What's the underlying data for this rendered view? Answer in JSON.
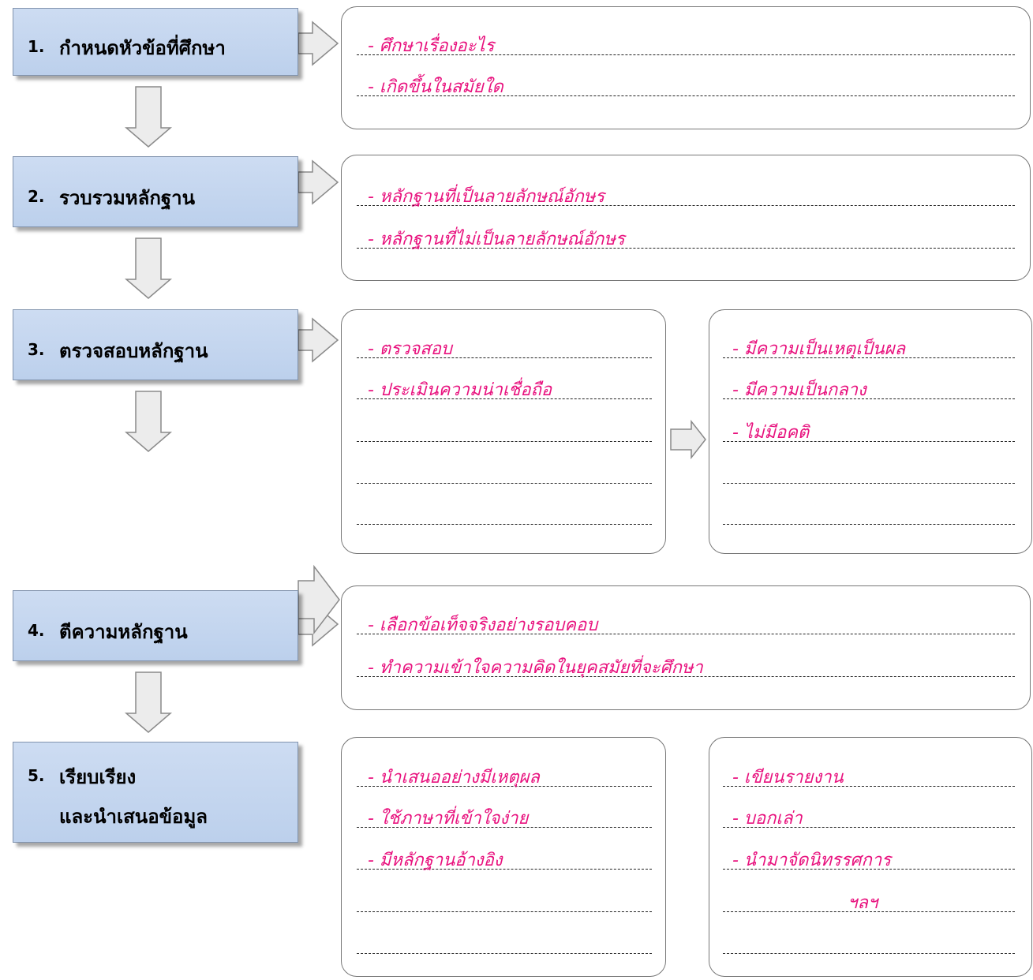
{
  "steps": [
    {
      "num": "1.",
      "label": "กำหนดหัวข้อที่ศึกษา"
    },
    {
      "num": "2.",
      "label": "รวบรวมหลักฐาน"
    },
    {
      "num": "3.",
      "label": "ตรวจสอบหลักฐาน"
    },
    {
      "num": "4.",
      "label": "ตีความหลักฐาน"
    },
    {
      "num": "5.",
      "label": "เรียบเรียง",
      "label2": "และนำเสนอข้อมูล"
    }
  ],
  "notes": {
    "step1": [
      "- ศึกษาเรื่องอะไร",
      "- เกิดขึ้นในสมัยใด"
    ],
    "step2": [
      "- หลักฐานที่เป็นลายลักษณ์อักษร",
      "- หลักฐานที่ไม่เป็นลายลักษณ์อักษร"
    ],
    "step3_left": [
      "- ตรวจสอบ",
      "- ประเมินความน่าเชื่อถือ"
    ],
    "step3_right": [
      "- มีความเป็นเหตุเป็นผล",
      "- มีความเป็นกลาง",
      "- ไม่มีอคติ"
    ],
    "step4": [
      "-  เลือกข้อเท็จจริงอย่างรอบคอบ",
      "- ทำความเข้าใจความคิดในยุคสมัยที่จะศึกษา"
    ],
    "step5_left": [
      "- นำเสนออย่างมีเหตุผล",
      "- ใช้ภาษาที่เข้าใจง่าย",
      "- มีหลักฐานอ้างอิง"
    ],
    "step5_right": [
      "- เขียนรายงาน",
      "- บอกเล่า",
      "- นำมาจัดนิทรรศการ",
      "ฯลฯ"
    ]
  }
}
